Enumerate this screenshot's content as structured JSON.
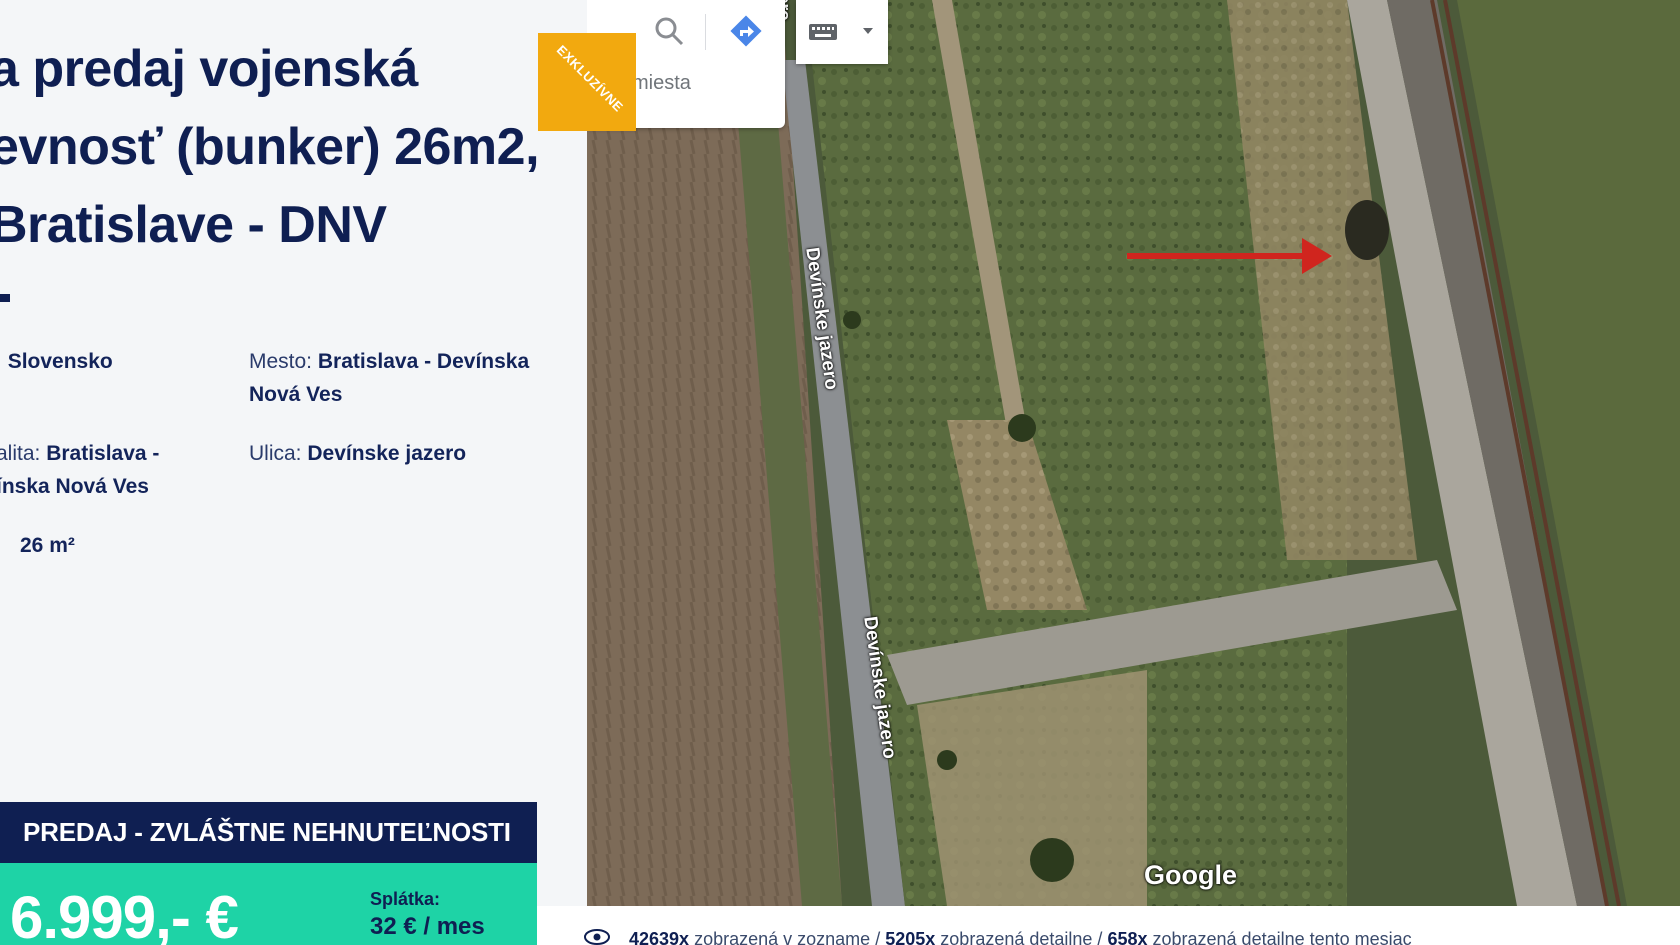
{
  "listing": {
    "title_line1": "a predaj vojenská",
    "title_line2": "evnosť (bunker) 26m2,",
    "title_line3": "Bratislave - DNV"
  },
  "properties": {
    "country_label": ":",
    "country_value": "Slovensko",
    "city_label": "Mesto:",
    "city_value": "Bratislava - Devínska Nová Ves",
    "locality_label": "alita:",
    "locality_value_1": "Bratislava -",
    "locality_value_2": "ínska Nová Ves",
    "street_label": "Ulica:",
    "street_value": "Devínske jazero",
    "area_value": "26 m²"
  },
  "category": "PREDAJ - ZVLÁŠTNE NEHNUTEĽNOSTI",
  "price": {
    "value": "6.999,- €",
    "installment_label": "Splátka:",
    "installment_value": "32 € / mes"
  },
  "badge": "EXKLUZÍVNE",
  "map": {
    "search_hint": "miesta",
    "road_label_1": "Devínske jazero",
    "road_label_2": "Devínske jazero",
    "road_label_top": "ero",
    "google_logo": "Google",
    "icons": [
      "search-icon",
      "directions-icon",
      "keyboard-icon",
      "caret-down-icon",
      "red-arrow"
    ]
  },
  "stats": {
    "list_views": "42639x",
    "list_views_text": "zobrazená v zozname /",
    "detail_views": "5205x",
    "detail_views_text": "zobrazená detailne /",
    "month_views": "658x",
    "month_views_text": "zobrazená detailne tento mesiac"
  },
  "colors": {
    "navy": "#0f1f52",
    "teal": "#1ed3a6",
    "badge_orange": "#f2a90f",
    "panel_bg": "#f4f6f8"
  }
}
